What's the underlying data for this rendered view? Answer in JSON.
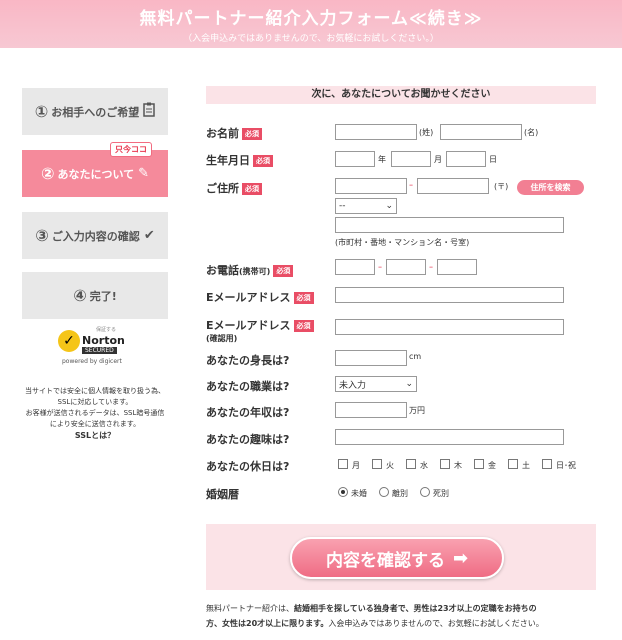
{
  "header": {
    "title": "無料パートナー紹介入力フォーム≪続き≫",
    "subtitle": "（入会申込みではありませんので、お気軽にお試しください。）"
  },
  "sidebar": {
    "steps": [
      {
        "num": "①",
        "label": "お相手へのご希望",
        "icon": "clipboard-icon",
        "glyph": "📋"
      },
      {
        "num": "②",
        "label": "あなたについて",
        "icon": "pencil-icon",
        "glyph": "✎"
      },
      {
        "num": "③",
        "label": "ご入力内容の確認",
        "icon": "check-icon",
        "glyph": "✔"
      },
      {
        "num": "④",
        "label": "完了!",
        "icon": "",
        "glyph": ""
      }
    ],
    "now_badge": "只今ココ",
    "norton": {
      "small": "保証する",
      "brand": "Norton",
      "secured": "SECURED",
      "powered": "powered by digicert"
    },
    "ssl_lines": [
      "当サイトでは安全に個人情報を取り扱う為、",
      "SSLに対応しています。",
      "お客様が送信されるデータは、SSL暗号通信",
      "により安全に送信されます。"
    ],
    "ssl_link": "SSLとは？"
  },
  "form": {
    "section_title": "次に、あなたについてお聞かせください",
    "required": "必須",
    "name": {
      "label": "お名前",
      "sei": "(姓)",
      "mei": "(名)"
    },
    "birth": {
      "label": "生年月日",
      "year": "年",
      "month": "月",
      "day": "日"
    },
    "address": {
      "label": "ご住所",
      "dash": "ｰ",
      "zip": "(〒)",
      "search_button": "住所を検索",
      "pref_value": "--",
      "hint": "(市町村・番地・マンション名・号室)"
    },
    "phone": {
      "label": "お電話",
      "label_sub": "(携帯可)",
      "dash": "ｰ"
    },
    "email": {
      "label": "Eメールアドレス"
    },
    "email_confirm": {
      "label": "Eメールアドレス",
      "sub": "(確認用)"
    },
    "height": {
      "label": "あなたの身長は?",
      "unit": "cm"
    },
    "job": {
      "label": "あなたの職業は?",
      "value": "未入力"
    },
    "income": {
      "label": "あなたの年収は?",
      "unit": "万円"
    },
    "hobby": {
      "label": "あなたの趣味は?"
    },
    "holiday": {
      "label": "あなたの休日は?",
      "days": [
        "月",
        "火",
        "水",
        "木",
        "金",
        "土",
        "日･祝"
      ]
    },
    "marriage": {
      "label": "婚姻暦",
      "options": [
        "未婚",
        "離別",
        "死別"
      ],
      "selected": 0
    },
    "submit": {
      "label": "内容を確認する",
      "arrow": "➡"
    }
  },
  "footnote": {
    "line1_a": "無料パートナー紹介は、",
    "line1_b": "結婚相手を探している独身者で、男性は23才以上の定職をお持ちの",
    "line2_b": "方、女性は20才以上に限ります。",
    "line2_c": "入会申込みではありませんので、お気軽にお試しください。"
  }
}
